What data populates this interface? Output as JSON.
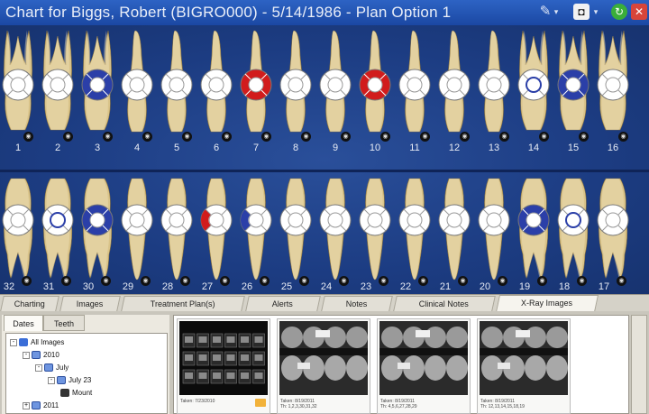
{
  "window": {
    "title": "Chart for Biggs, Robert (BIGRO000) - 5/14/1986 - Plan Option 1",
    "toolbar_icons": [
      "perio-tool-icon",
      "dropdown-icon",
      "camera-icon",
      "dropdown-icon",
      "go-icon",
      "close-icon"
    ]
  },
  "colors": {
    "chart_bg": "#1c3c82",
    "treated": "#d11c1c",
    "existing": "#2b3fa8",
    "tooth": "#e8d8a0"
  },
  "teeth": {
    "upper": [
      {
        "num": "1",
        "status": "none"
      },
      {
        "num": "2",
        "status": "none"
      },
      {
        "num": "3",
        "status": "existing-full"
      },
      {
        "num": "4",
        "status": "none"
      },
      {
        "num": "5",
        "status": "none"
      },
      {
        "num": "6",
        "status": "none"
      },
      {
        "num": "7",
        "status": "treated-full"
      },
      {
        "num": "8",
        "status": "none"
      },
      {
        "num": "9",
        "status": "none"
      },
      {
        "num": "10",
        "status": "treated-full"
      },
      {
        "num": "11",
        "status": "none"
      },
      {
        "num": "12",
        "status": "none"
      },
      {
        "num": "13",
        "status": "none"
      },
      {
        "num": "14",
        "status": "existing-outline"
      },
      {
        "num": "15",
        "status": "existing-full"
      },
      {
        "num": "16",
        "status": "none"
      }
    ],
    "lower": [
      {
        "num": "32",
        "status": "none"
      },
      {
        "num": "31",
        "status": "existing-outline"
      },
      {
        "num": "30",
        "status": "existing-full"
      },
      {
        "num": "29",
        "status": "none"
      },
      {
        "num": "28",
        "status": "none"
      },
      {
        "num": "27",
        "status": "treated-left"
      },
      {
        "num": "26",
        "status": "existing-left"
      },
      {
        "num": "25",
        "status": "none"
      },
      {
        "num": "24",
        "status": "none"
      },
      {
        "num": "23",
        "status": "none"
      },
      {
        "num": "22",
        "status": "none"
      },
      {
        "num": "21",
        "status": "none"
      },
      {
        "num": "20",
        "status": "none"
      },
      {
        "num": "19",
        "status": "existing-full"
      },
      {
        "num": "18",
        "status": "existing-ring"
      },
      {
        "num": "17",
        "status": "none"
      }
    ]
  },
  "tabs": [
    "Charting",
    "Images",
    "Treatment Plan(s)",
    "Alerts",
    "Notes",
    "Clinical Notes",
    "X-Ray Images"
  ],
  "active_tab": "X-Ray Images",
  "side_tabs": [
    "Dates",
    "Teeth"
  ],
  "tree": [
    {
      "label": "All Images",
      "level": 0,
      "exp": "-",
      "icon": "blue"
    },
    {
      "label": "2010",
      "level": 1,
      "exp": "-",
      "icon": "cal"
    },
    {
      "label": "July",
      "level": 2,
      "exp": "-",
      "icon": "cal"
    },
    {
      "label": "July 23",
      "level": 3,
      "exp": "-",
      "icon": "cal"
    },
    {
      "label": "Mount",
      "level": 4,
      "exp": "",
      "icon": "dark"
    },
    {
      "label": "2011",
      "level": 1,
      "exp": "+",
      "icon": "cal"
    }
  ],
  "thumbnails": [
    {
      "caption": "Taken: 7/23/2010",
      "type": "panoramic"
    },
    {
      "caption": "Taken: 8/19/2011  Th: 1,2,3,30,31,32",
      "type": "bitewing"
    },
    {
      "caption": "Taken: 8/19/2011  Th: 4,5,6,27,28,29",
      "type": "bitewing"
    },
    {
      "caption": "Taken: 8/19/2011  Th: 12,13,14,15,18,19",
      "type": "bitewing"
    }
  ]
}
